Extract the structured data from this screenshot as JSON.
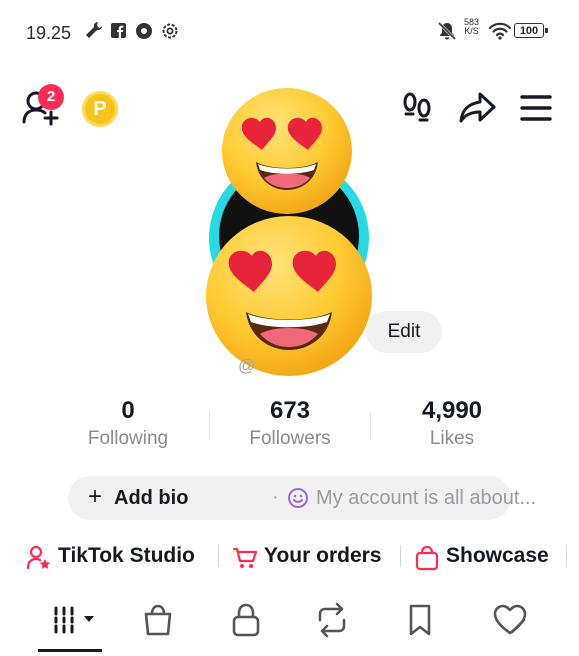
{
  "status_bar": {
    "time": "19.25",
    "net_speed": "583",
    "net_unit": "K/S",
    "battery": "100"
  },
  "header": {
    "notification_count": "2",
    "coin_letter": "P"
  },
  "profile": {
    "edit_label": "Edit",
    "handle": "@"
  },
  "stats": [
    {
      "value": "0",
      "label": "Following"
    },
    {
      "value": "673",
      "label": "Followers"
    },
    {
      "value": "4,990",
      "label": "Likes"
    }
  ],
  "bio": {
    "add_label": "Add bio",
    "separator": "·",
    "placeholder": "My account is all about..."
  },
  "quick_links": [
    {
      "label": "TikTok Studio",
      "icon": "person-star-icon"
    },
    {
      "label": "Your orders",
      "icon": "cart-icon"
    },
    {
      "label": "Showcase",
      "icon": "shopping-bag-icon"
    }
  ],
  "tabs": [
    {
      "icon": "grid-icon",
      "active": true
    },
    {
      "icon": "shop-bag-icon"
    },
    {
      "icon": "lock-icon"
    },
    {
      "icon": "repost-icon"
    },
    {
      "icon": "bookmark-icon"
    },
    {
      "icon": "liked-heart-icon"
    }
  ],
  "colors": {
    "accent": "#fe2c55",
    "avatar_ring": "#25d9e5",
    "coin": "#f8c21b",
    "pill_bg": "#f1f1f2"
  }
}
